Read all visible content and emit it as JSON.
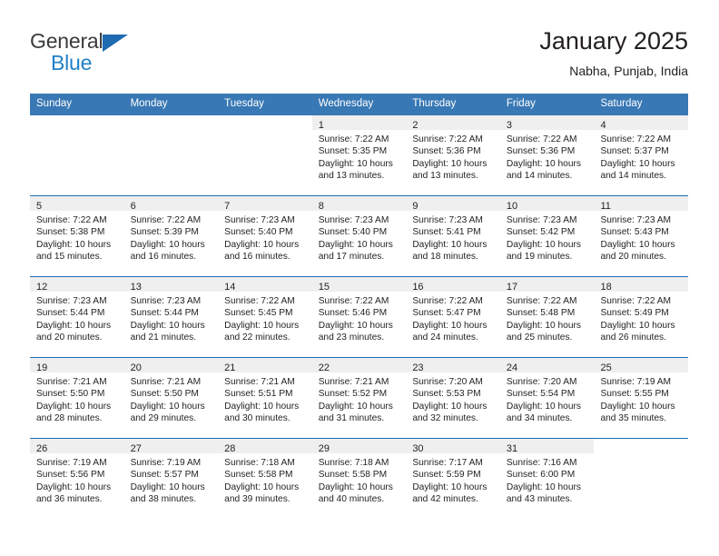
{
  "brand": {
    "name_top": "General",
    "name_bottom": "Blue",
    "triangle_color": "#1f6bb0",
    "top_color": "#3b3b3b",
    "bottom_color": "#2081c6"
  },
  "header": {
    "title": "January 2025",
    "subtitle": "Nabha, Punjab, India",
    "header_bg": "#3878b4",
    "header_text": "#ffffff",
    "week_rule": "#1f6bb0",
    "daynum_band": "#efefef"
  },
  "weekdays": [
    "Sunday",
    "Monday",
    "Tuesday",
    "Wednesday",
    "Thursday",
    "Friday",
    "Saturday"
  ],
  "labels": {
    "sunrise": "Sunrise:",
    "sunset": "Sunset:",
    "daylight": "Daylight:"
  },
  "weeks": [
    [
      {
        "day": "",
        "blank": true
      },
      {
        "day": "",
        "blank": true
      },
      {
        "day": "",
        "blank": true
      },
      {
        "day": "1",
        "l1": "Sunrise: 7:22 AM",
        "l2": "Sunset: 5:35 PM",
        "l3": "Daylight: 10 hours",
        "l4": "and 13 minutes."
      },
      {
        "day": "2",
        "l1": "Sunrise: 7:22 AM",
        "l2": "Sunset: 5:36 PM",
        "l3": "Daylight: 10 hours",
        "l4": "and 13 minutes."
      },
      {
        "day": "3",
        "l1": "Sunrise: 7:22 AM",
        "l2": "Sunset: 5:36 PM",
        "l3": "Daylight: 10 hours",
        "l4": "and 14 minutes."
      },
      {
        "day": "4",
        "l1": "Sunrise: 7:22 AM",
        "l2": "Sunset: 5:37 PM",
        "l3": "Daylight: 10 hours",
        "l4": "and 14 minutes."
      }
    ],
    [
      {
        "day": "5",
        "l1": "Sunrise: 7:22 AM",
        "l2": "Sunset: 5:38 PM",
        "l3": "Daylight: 10 hours",
        "l4": "and 15 minutes."
      },
      {
        "day": "6",
        "l1": "Sunrise: 7:22 AM",
        "l2": "Sunset: 5:39 PM",
        "l3": "Daylight: 10 hours",
        "l4": "and 16 minutes."
      },
      {
        "day": "7",
        "l1": "Sunrise: 7:23 AM",
        "l2": "Sunset: 5:40 PM",
        "l3": "Daylight: 10 hours",
        "l4": "and 16 minutes."
      },
      {
        "day": "8",
        "l1": "Sunrise: 7:23 AM",
        "l2": "Sunset: 5:40 PM",
        "l3": "Daylight: 10 hours",
        "l4": "and 17 minutes."
      },
      {
        "day": "9",
        "l1": "Sunrise: 7:23 AM",
        "l2": "Sunset: 5:41 PM",
        "l3": "Daylight: 10 hours",
        "l4": "and 18 minutes."
      },
      {
        "day": "10",
        "l1": "Sunrise: 7:23 AM",
        "l2": "Sunset: 5:42 PM",
        "l3": "Daylight: 10 hours",
        "l4": "and 19 minutes."
      },
      {
        "day": "11",
        "l1": "Sunrise: 7:23 AM",
        "l2": "Sunset: 5:43 PM",
        "l3": "Daylight: 10 hours",
        "l4": "and 20 minutes."
      }
    ],
    [
      {
        "day": "12",
        "l1": "Sunrise: 7:23 AM",
        "l2": "Sunset: 5:44 PM",
        "l3": "Daylight: 10 hours",
        "l4": "and 20 minutes."
      },
      {
        "day": "13",
        "l1": "Sunrise: 7:23 AM",
        "l2": "Sunset: 5:44 PM",
        "l3": "Daylight: 10 hours",
        "l4": "and 21 minutes."
      },
      {
        "day": "14",
        "l1": "Sunrise: 7:22 AM",
        "l2": "Sunset: 5:45 PM",
        "l3": "Daylight: 10 hours",
        "l4": "and 22 minutes."
      },
      {
        "day": "15",
        "l1": "Sunrise: 7:22 AM",
        "l2": "Sunset: 5:46 PM",
        "l3": "Daylight: 10 hours",
        "l4": "and 23 minutes."
      },
      {
        "day": "16",
        "l1": "Sunrise: 7:22 AM",
        "l2": "Sunset: 5:47 PM",
        "l3": "Daylight: 10 hours",
        "l4": "and 24 minutes."
      },
      {
        "day": "17",
        "l1": "Sunrise: 7:22 AM",
        "l2": "Sunset: 5:48 PM",
        "l3": "Daylight: 10 hours",
        "l4": "and 25 minutes."
      },
      {
        "day": "18",
        "l1": "Sunrise: 7:22 AM",
        "l2": "Sunset: 5:49 PM",
        "l3": "Daylight: 10 hours",
        "l4": "and 26 minutes."
      }
    ],
    [
      {
        "day": "19",
        "l1": "Sunrise: 7:21 AM",
        "l2": "Sunset: 5:50 PM",
        "l3": "Daylight: 10 hours",
        "l4": "and 28 minutes."
      },
      {
        "day": "20",
        "l1": "Sunrise: 7:21 AM",
        "l2": "Sunset: 5:50 PM",
        "l3": "Daylight: 10 hours",
        "l4": "and 29 minutes."
      },
      {
        "day": "21",
        "l1": "Sunrise: 7:21 AM",
        "l2": "Sunset: 5:51 PM",
        "l3": "Daylight: 10 hours",
        "l4": "and 30 minutes."
      },
      {
        "day": "22",
        "l1": "Sunrise: 7:21 AM",
        "l2": "Sunset: 5:52 PM",
        "l3": "Daylight: 10 hours",
        "l4": "and 31 minutes."
      },
      {
        "day": "23",
        "l1": "Sunrise: 7:20 AM",
        "l2": "Sunset: 5:53 PM",
        "l3": "Daylight: 10 hours",
        "l4": "and 32 minutes."
      },
      {
        "day": "24",
        "l1": "Sunrise: 7:20 AM",
        "l2": "Sunset: 5:54 PM",
        "l3": "Daylight: 10 hours",
        "l4": "and 34 minutes."
      },
      {
        "day": "25",
        "l1": "Sunrise: 7:19 AM",
        "l2": "Sunset: 5:55 PM",
        "l3": "Daylight: 10 hours",
        "l4": "and 35 minutes."
      }
    ],
    [
      {
        "day": "26",
        "l1": "Sunrise: 7:19 AM",
        "l2": "Sunset: 5:56 PM",
        "l3": "Daylight: 10 hours",
        "l4": "and 36 minutes."
      },
      {
        "day": "27",
        "l1": "Sunrise: 7:19 AM",
        "l2": "Sunset: 5:57 PM",
        "l3": "Daylight: 10 hours",
        "l4": "and 38 minutes."
      },
      {
        "day": "28",
        "l1": "Sunrise: 7:18 AM",
        "l2": "Sunset: 5:58 PM",
        "l3": "Daylight: 10 hours",
        "l4": "and 39 minutes."
      },
      {
        "day": "29",
        "l1": "Sunrise: 7:18 AM",
        "l2": "Sunset: 5:58 PM",
        "l3": "Daylight: 10 hours",
        "l4": "and 40 minutes."
      },
      {
        "day": "30",
        "l1": "Sunrise: 7:17 AM",
        "l2": "Sunset: 5:59 PM",
        "l3": "Daylight: 10 hours",
        "l4": "and 42 minutes."
      },
      {
        "day": "31",
        "l1": "Sunrise: 7:16 AM",
        "l2": "Sunset: 6:00 PM",
        "l3": "Daylight: 10 hours",
        "l4": "and 43 minutes."
      },
      {
        "day": "",
        "blank": true
      }
    ]
  ]
}
